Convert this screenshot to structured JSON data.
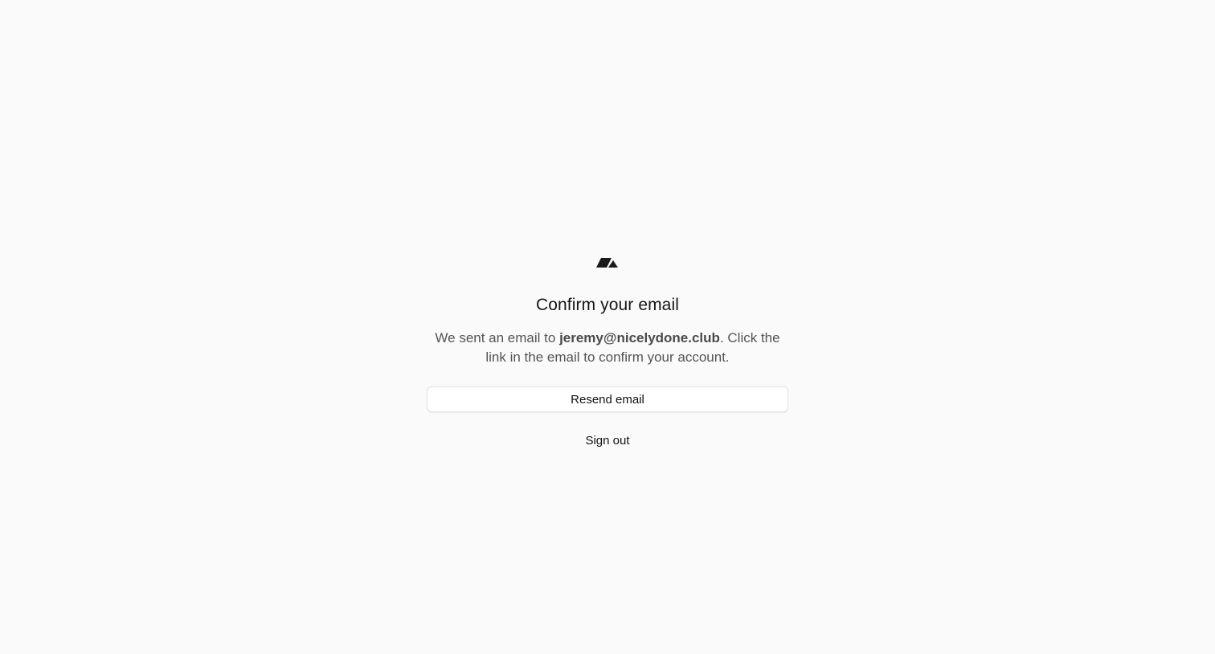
{
  "brand": {
    "logo_icon": "brand-logo-icon",
    "logo_color": "#1a1a1a"
  },
  "confirm": {
    "title": "Confirm your email",
    "desc_prefix": "We sent an email to ",
    "email": "jeremy@nicelydone.club",
    "desc_suffix": ". Click the link in the email to confirm your account."
  },
  "actions": {
    "resend_label": "Resend email",
    "signout_label": "Sign out"
  },
  "colors": {
    "background": "#fafafa",
    "text_primary": "#161616",
    "text_secondary": "#545454"
  }
}
